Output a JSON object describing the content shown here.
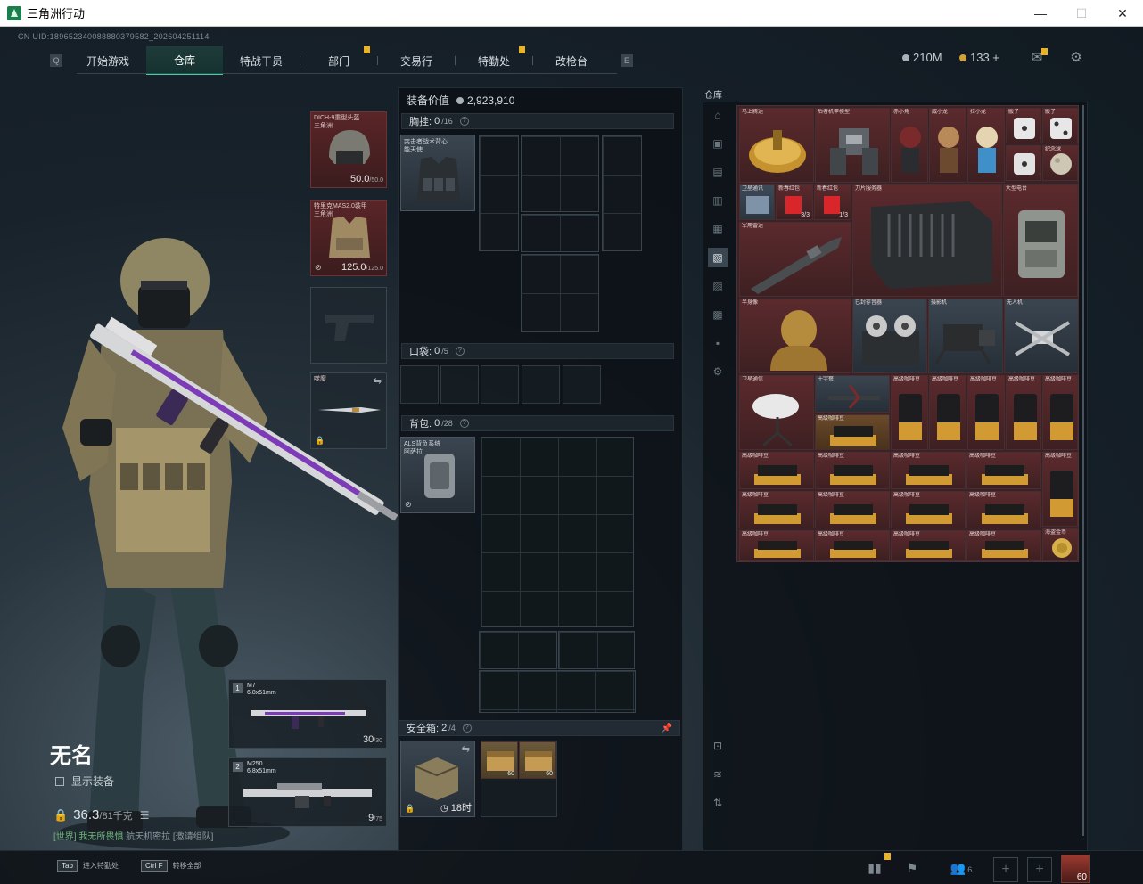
{
  "window": {
    "title": "三角洲行动",
    "controls": [
      "—",
      "☐",
      "✕"
    ]
  },
  "uid": "CN UID:189652340088880379582_202604251114",
  "nav": {
    "tabs": [
      {
        "label": "开始游戏",
        "active": false,
        "notice": false
      },
      {
        "label": "仓库",
        "active": true,
        "notice": false
      },
      {
        "label": "特战干员",
        "active": false,
        "notice": false
      },
      {
        "label": "部门",
        "active": false,
        "notice": true
      },
      {
        "label": "交易行",
        "active": false,
        "notice": false
      },
      {
        "label": "特勤处",
        "active": false,
        "notice": true
      },
      {
        "label": "改枪台",
        "active": false,
        "notice": false
      }
    ],
    "left_edge": "Q",
    "right_edge": "E"
  },
  "currency": {
    "money": "210M",
    "coins": "133 +"
  },
  "colors": {
    "accent": "#37d6a4",
    "rare_red": "#5b2a2d",
    "notice": "#e8b326",
    "gold": "#d2a13a"
  },
  "character": {
    "name": "无名",
    "show_equipment": "显示装备",
    "weight": "36.3",
    "weight_cap": "/81千克"
  },
  "chat": {
    "channel": "[世界]",
    "user": "我无所畏惧",
    "message": "航天机密拉",
    "invite": "[邀请组队]"
  },
  "equipment": {
    "helmet": {
      "name": "DICH-9重型头盔",
      "sub": "三角洲",
      "durability": "50.0",
      "max": "/50.0"
    },
    "armor": {
      "name": "特里克MAS2.0装甲",
      "sub": "三角洲",
      "durability": "125.0",
      "max": "/125.0"
    },
    "melee": {
      "name": "噬魔"
    }
  },
  "weapons": [
    {
      "slot": "1",
      "name": "M7",
      "caliber": "6.8x51mm",
      "ammo": "30",
      "max": "/30"
    },
    {
      "slot": "2",
      "name": "M250",
      "caliber": "6.8x51mm",
      "ammo": "9",
      "max": "/75"
    }
  ],
  "loadout": {
    "value_label": "装备价值",
    "value": "2,923,910",
    "chest": {
      "label": "胸挂:",
      "count": "0",
      "cap": "/16",
      "item": "突击者战术背心",
      "item_sub": "能天使"
    },
    "pockets": {
      "label": "口袋:",
      "count": "0",
      "cap": "/5"
    },
    "backpack": {
      "label": "背包:",
      "count": "0",
      "cap": "/28",
      "item": "ALS背负系统",
      "item_sub": "阿萨拉"
    },
    "safebox": {
      "label": "安全箱:",
      "count": "2",
      "cap": "/4",
      "timer": "18时",
      "ammo_qty": [
        "60",
        "60"
      ]
    }
  },
  "warehouse": {
    "title": "仓库",
    "side_icons": [
      "home-icon",
      "ammo-tab-icon",
      "gear-tab-icon",
      "medical-tab-icon",
      "ammo2-tab-icon",
      "valuables-tab-icon",
      "mods-tab-icon",
      "keys-tab-icon",
      "misc-tab-icon",
      "settings-tab-icon"
    ],
    "bottom_icons": [
      "locker-icon",
      "layers-icon",
      "sort-icon"
    ],
    "items": [
      {
        "label": "马上腾达",
        "qty": ""
      },
      {
        "label": "后者机甲模型",
        "qty": ""
      },
      {
        "label": "赤小角",
        "qty": ""
      },
      {
        "label": "威小龙",
        "qty": ""
      },
      {
        "label": "拉小龙",
        "qty": ""
      },
      {
        "label": "骰子",
        "qty": ""
      },
      {
        "label": "骰子",
        "qty": ""
      },
      {
        "label": "纪念球",
        "qty": ""
      },
      {
        "label": "卫星通讯",
        "qty": ""
      },
      {
        "label": "新春红包",
        "qty": "3/3"
      },
      {
        "label": "新春红包",
        "qty": "1/3"
      },
      {
        "label": "刀片服务器",
        "qty": ""
      },
      {
        "label": "大型电台",
        "qty": ""
      },
      {
        "label": "军用雷达",
        "qty": ""
      },
      {
        "label": "半身像",
        "qty": ""
      },
      {
        "label": "已封存音器",
        "qty": ""
      },
      {
        "label": "摄影机",
        "qty": ""
      },
      {
        "label": "无人机",
        "qty": ""
      },
      {
        "label": "卫星通信",
        "qty": ""
      },
      {
        "label": "十字弩",
        "qty": ""
      },
      {
        "label": "高级咖啡豆",
        "qty": ""
      },
      {
        "label": "高级咖啡豆",
        "qty": ""
      },
      {
        "label": "高级咖啡豆",
        "qty": ""
      },
      {
        "label": "高级咖啡豆",
        "qty": ""
      },
      {
        "label": "高级咖啡豆",
        "qty": ""
      },
      {
        "label": "高级咖啡豆",
        "qty": ""
      },
      {
        "label": "高级咖啡豆",
        "qty": ""
      },
      {
        "label": "高级咖啡豆",
        "qty": ""
      },
      {
        "label": "高级咖啡豆",
        "qty": ""
      },
      {
        "label": "高级咖啡豆",
        "qty": ""
      },
      {
        "label": "高级咖啡豆",
        "qty": ""
      },
      {
        "label": "高级咖啡豆",
        "qty": ""
      },
      {
        "label": "海盗金币",
        "qty": ""
      }
    ]
  },
  "bottom": {
    "hint1_key": "Tab",
    "hint1": "进入特勤处",
    "hint2_key": "Ctrl F",
    "hint2": "转移全部",
    "squad_count": "6",
    "avatar_level": "60"
  }
}
